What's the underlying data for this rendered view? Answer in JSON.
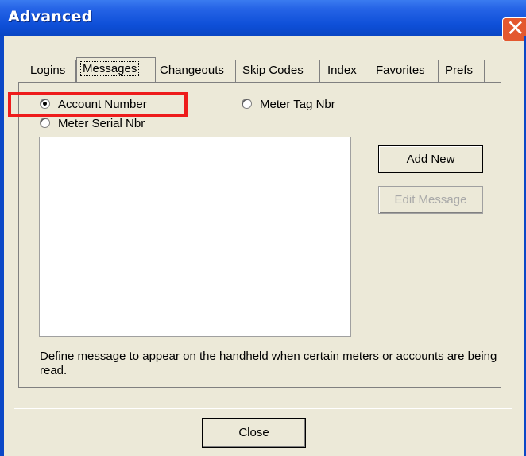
{
  "window": {
    "title": "Advanced"
  },
  "tabs": [
    {
      "label": "Logins",
      "active": false
    },
    {
      "label": "Messages",
      "active": true
    },
    {
      "label": "Changeouts",
      "active": false
    },
    {
      "label": "Skip Codes",
      "active": false
    },
    {
      "label": "Index",
      "active": false
    },
    {
      "label": "Favorites",
      "active": false
    },
    {
      "label": "Prefs",
      "active": false
    }
  ],
  "options": {
    "account_number": {
      "label": "Account Number",
      "selected": true
    },
    "meter_tag": {
      "label": "Meter Tag Nbr",
      "selected": false
    },
    "meter_serial": {
      "label": "Meter Serial Nbr",
      "selected": false
    }
  },
  "buttons": {
    "add_new": "Add New",
    "edit_message": "Edit Message",
    "close": "Close"
  },
  "description": "Define message to appear on the handheld when certain meters or accounts are being read.",
  "colors": {
    "titlebar": "#0e4fd8",
    "highlight": "#ee1c1c",
    "face": "#ece9d8"
  }
}
